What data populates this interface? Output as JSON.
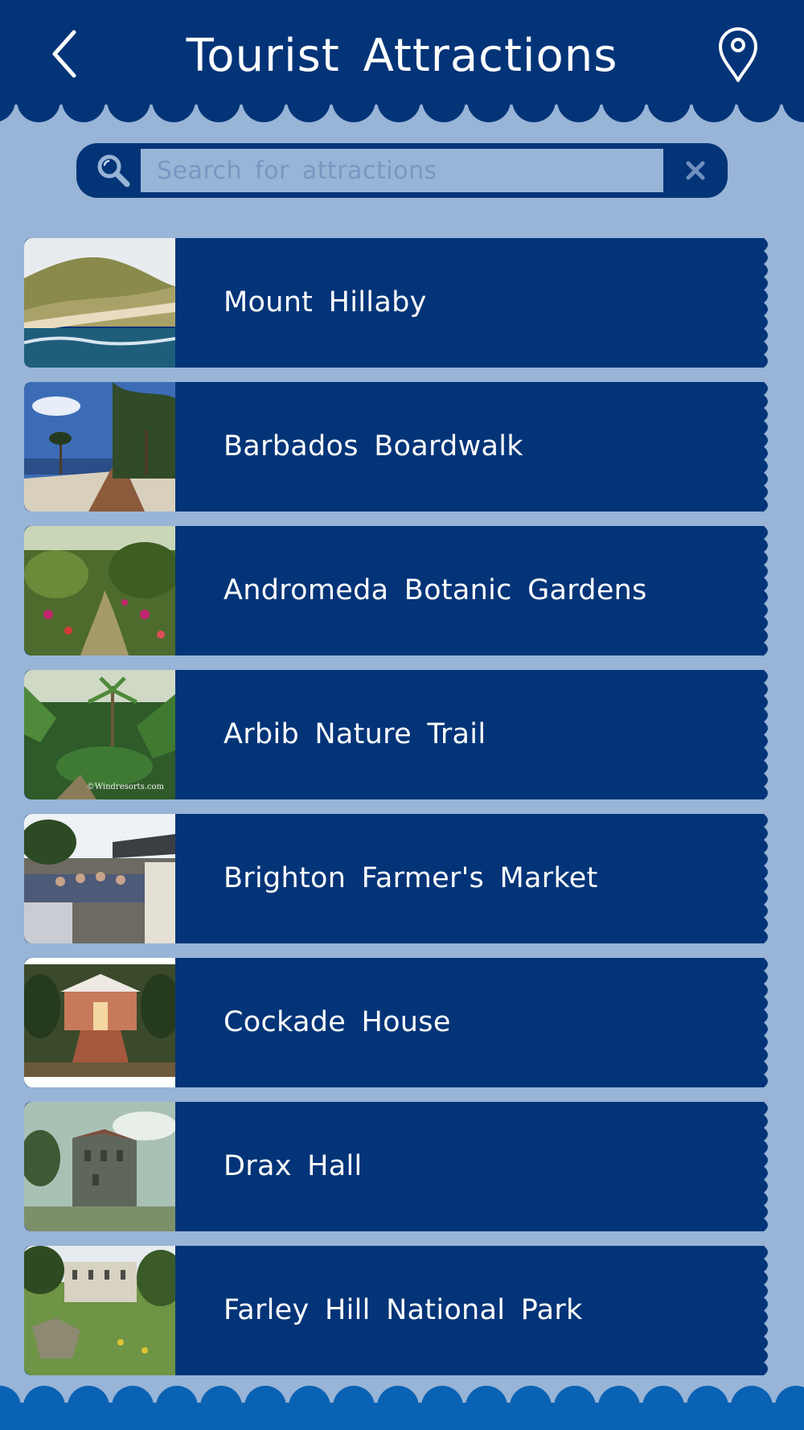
{
  "header": {
    "title": "Tourist Attractions",
    "back_icon": "chevron-left-icon",
    "map_icon": "map-pin-icon",
    "background": "#033478"
  },
  "search": {
    "placeholder": "Search for attractions",
    "value": "",
    "search_icon": "search-icon",
    "clear_icon": "close-icon"
  },
  "attractions": [
    {
      "name": "Mount Hillaby",
      "image": "coastline-hills-photo"
    },
    {
      "name": "Barbados Boardwalk",
      "image": "beach-boardwalk-photo"
    },
    {
      "name": "Andromeda Botanic Gardens",
      "image": "botanic-garden-photo"
    },
    {
      "name": "Arbib Nature Trail",
      "image": "tropical-forest-photo",
      "watermark": "©Windresorts.com"
    },
    {
      "name": "Brighton Farmer's Market",
      "image": "market-stalls-photo"
    },
    {
      "name": "Cockade House",
      "image": "colonial-house-photo"
    },
    {
      "name": "Drax Hall",
      "image": "stone-manor-photo"
    },
    {
      "name": "Farley Hill National Park",
      "image": "park-ruins-photo"
    }
  ],
  "colors": {
    "page_background": "#98b4d6",
    "bar_navy": "#033478",
    "footer_blue": "#0a62b4",
    "text": "#ffffff"
  }
}
